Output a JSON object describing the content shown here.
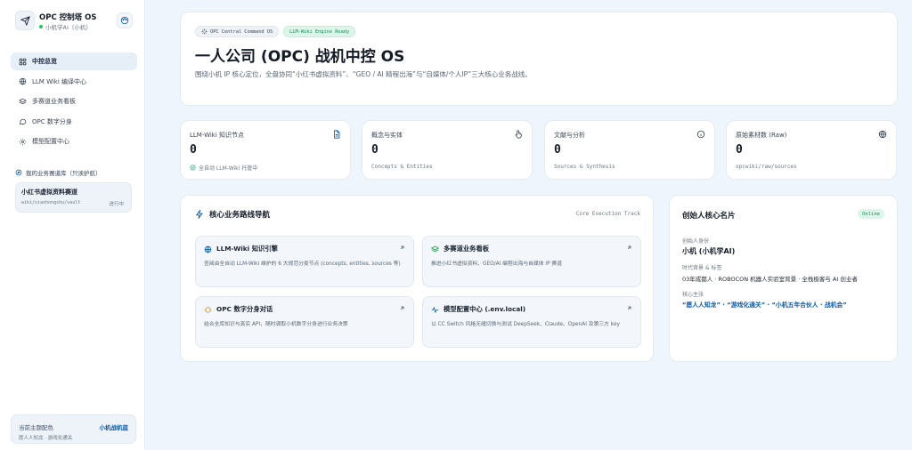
{
  "brand": {
    "title": "OPC 控制塔 OS",
    "subtitle": "小机学AI（小机）"
  },
  "nav": [
    {
      "label": "中控总览",
      "active": true
    },
    {
      "label": "LLM Wiki 编译中心",
      "active": false
    },
    {
      "label": "多赛道业务看板",
      "active": false
    },
    {
      "label": "OPC 数字分身",
      "active": false
    },
    {
      "label": "模型配置中心",
      "active": false
    }
  ],
  "tracks": {
    "heading": "我的业务赛道库（只读护航）",
    "items": [
      {
        "name": "小红书虚拟资料赛道",
        "path": "wiki/xiaohongshu/vault",
        "status": "进行中"
      }
    ]
  },
  "theme": {
    "label": "当前主题配色",
    "name": "小机战机蓝",
    "tags": "愿人人知龙 · 游戏化通关"
  },
  "hero": {
    "badge_primary": "OPC Central Command OS",
    "badge_secondary": "LLM-Wiki Engine Ready",
    "title": "一人公司 (OPC) 战机中控 OS",
    "description": "围绕小机 IP 核心定位，全盘协同“小红书虚拟资料”、“GEO / AI 精程出海”与“自媒体/个人IP”三大核心业务战线。"
  },
  "stats": [
    {
      "label": "LLM-Wiki 知识节点",
      "value": "0",
      "foot": "全自动 LLM-Wiki 托管中",
      "icon": "document-icon"
    },
    {
      "label": "概念与实体",
      "value": "0",
      "foot": "Concepts & Entities",
      "icon": "pointer-icon"
    },
    {
      "label": "文献与分析",
      "value": "0",
      "foot": "Sources & Synthesis",
      "icon": "info-icon"
    },
    {
      "label": "原始素材数 (Raw)",
      "value": "0",
      "foot": "opcwiki/raw/sources",
      "icon": "globe-icon"
    }
  ],
  "business": {
    "title": "核心业务路线导航",
    "track_label": "Core Execution Track",
    "tiles": [
      {
        "title": "LLM-Wiki 知识引擎",
        "desc": "查阅由全自动 LLM-Wiki 维护的 6 大规范分类节点 (concepts, entities, sources 等)",
        "icon": "globe-icon"
      },
      {
        "title": "多赛道业务看板",
        "desc": "推进小红书虚拟资料、GEO/AI 编程出海与自媒体 IP 赛道",
        "icon": "layers-icon"
      },
      {
        "title": "OPC 数字分身对话",
        "desc": "结合全库知识与真实 API，随时调取小机数字分身进行业务决策",
        "icon": "sparkle-icon"
      },
      {
        "title": "模型配置中心 (.env.local)",
        "desc": "以 CC Switch 风格无缝切换与测试 DeepSeek、Claude、OpenAI 及第三方 key",
        "icon": "pulse-icon"
      }
    ]
  },
  "founder": {
    "title": "创始人核心名片",
    "status": "Online",
    "identity_label": "创始人身份",
    "identity_value": "小机 (小机学AI)",
    "background_label": "时代背景 & 标签",
    "background_value": "03年成都人 · ROBOCON 机器人实验室背景 · 全栈极客与 AI 创业者",
    "motto_label": "核心主张",
    "motto_value": "“愿人人知龙” · “游戏化通关” · “小机五年合伙人 · 战机会”"
  },
  "colors": {
    "accent": "#0b5aa8",
    "online": "#22c55e",
    "background": "#eef5fc"
  }
}
